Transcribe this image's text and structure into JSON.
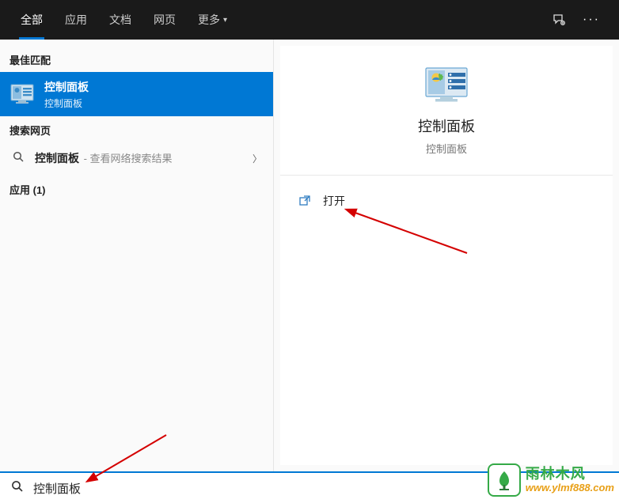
{
  "tabs": {
    "all": "全部",
    "apps": "应用",
    "docs": "文档",
    "web": "网页",
    "more": "更多"
  },
  "sections": {
    "best_match": "最佳匹配",
    "search_web": "搜索网页",
    "apps_count": "应用 (1)"
  },
  "result": {
    "title": "控制面板",
    "subtitle": "控制面板"
  },
  "web": {
    "term": "控制面板",
    "hint": " - 查看网络搜索结果"
  },
  "preview": {
    "title": "控制面板",
    "subtitle": "控制面板"
  },
  "actions": {
    "open": "打开"
  },
  "search": {
    "value": "控制面板"
  },
  "watermark": {
    "name": "雨林木风",
    "url": "www.ylmf888.com"
  }
}
